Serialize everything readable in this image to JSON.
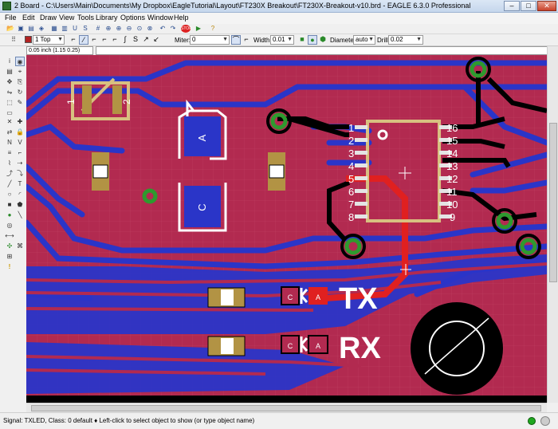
{
  "window": {
    "title": "2 Board - C:\\Users\\Main\\Documents\\My Dropbox\\EagleTutorial\\Layout\\FT230X Breakout\\FT230X-Breakout-v10.brd - EAGLE 6.3.0 Professional",
    "minimize": "–",
    "maximize": "□",
    "close": "✕"
  },
  "menu": [
    "File",
    "Edit",
    "Draw",
    "View",
    "Tools",
    "Library",
    "Options",
    "Window",
    "Help"
  ],
  "toolbar": {
    "icons": [
      "open-icon",
      "save-icon",
      "print-icon",
      "cam-icon",
      "board-icon",
      "schematic-icon",
      "ulp-icon",
      "script-icon",
      "grid-icon",
      "zoom-fit-icon",
      "zoom-in-icon",
      "zoom-out-icon",
      "zoom-redraw-icon",
      "zoom-select-icon",
      "undo-icon",
      "redo-icon",
      "stop-icon",
      "go-icon",
      "help-icon"
    ]
  },
  "params": {
    "layer": "1 Top",
    "miter_label": "Miter:",
    "miter_value": "0",
    "width_label": "Width:",
    "width_value": "0.01",
    "diameter_label": "Diameter:",
    "diameter_value": "auto",
    "drill_label": "Drill:",
    "drill_value": "0.02"
  },
  "coords": {
    "readout": "0.05 inch (1.15 0.25)",
    "command": ""
  },
  "board": {
    "labels": {
      "tx": "TX",
      "rx": "RX",
      "diode_a": "A",
      "diode_c": "C",
      "c_small": "C",
      "a_small": "A",
      "pad1": "1",
      "pad2": "2"
    },
    "ic_pins_left": [
      "1",
      "2",
      "3",
      "4",
      "5",
      "6",
      "7",
      "8"
    ],
    "ic_pins_right": [
      "16",
      "15",
      "14",
      "13",
      "12",
      "11",
      "10",
      "9"
    ]
  },
  "status": {
    "text": "Signal: TXLED, Class: 0 default  ♦ Left-click to select object to show (or type object name)"
  },
  "colors": {
    "board_bg": "#000000",
    "top_copper": "#b22a50",
    "bottom_copper": "#2a35c8",
    "selected": "#e02020",
    "pads": "#2e9a2e",
    "silk": "#ffffff",
    "package": "#d8c080"
  }
}
